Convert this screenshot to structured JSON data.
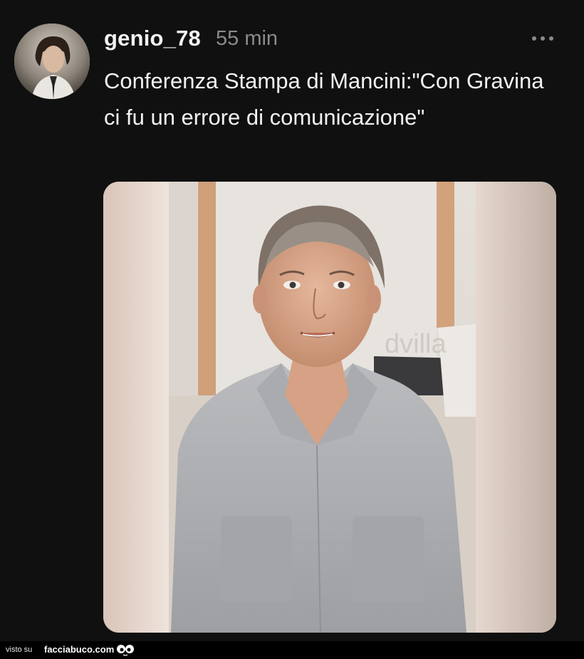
{
  "post": {
    "username": "genio_78",
    "timestamp": "55 min",
    "text": "Conferenza Stampa di Mancini:\"Con Gravina ci fu un errore di comunicazione\"",
    "more_icon": "more-horizontal-icon"
  },
  "media": {
    "watermark": "dvilla"
  },
  "footer": {
    "visto_label": "visto su",
    "brand": "facciabuco.com"
  }
}
